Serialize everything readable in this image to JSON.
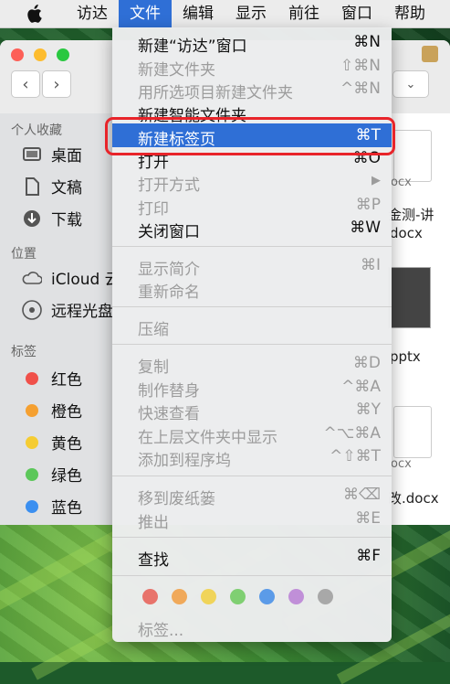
{
  "menubar": {
    "items": [
      "访达",
      "文件",
      "编辑",
      "显示",
      "前往",
      "窗口",
      "帮助"
    ],
    "active_index": 1
  },
  "sidebar": {
    "favorites_header": "个人收藏",
    "favorites": [
      "桌面",
      "文稿",
      "下载"
    ],
    "locations_header": "位置",
    "locations": [
      "iCloud 云",
      "远程光盘"
    ],
    "tags_header": "标签",
    "tags": [
      {
        "label": "红色",
        "color": "#f0504a"
      },
      {
        "label": "橙色",
        "color": "#f5a031"
      },
      {
        "label": "黄色",
        "color": "#f5cc33"
      },
      {
        "label": "绿色",
        "color": "#5cc75a"
      },
      {
        "label": "蓝色",
        "color": "#3b8ff0"
      }
    ]
  },
  "content": {
    "files": [
      "ocx",
      "金测-讲",
      "docx",
      "pptx",
      "ocx",
      "改.docx"
    ]
  },
  "file_menu": {
    "items": [
      {
        "label": "新建“访达”窗口",
        "shortcut": "⌘N",
        "enabled": true
      },
      {
        "label": "新建文件夹",
        "shortcut": "⇧⌘N",
        "enabled": false
      },
      {
        "label": "用所选项目新建文件夹",
        "shortcut": "^⌘N",
        "enabled": false
      },
      {
        "label": "新建智能文件夹",
        "shortcut": "",
        "enabled": true
      },
      {
        "label": "新建标签页",
        "shortcut": "⌘T",
        "enabled": true,
        "highlighted": true
      },
      {
        "label": "打开",
        "shortcut": "⌘O",
        "enabled": true
      },
      {
        "label": "打开方式",
        "shortcut": "▶",
        "enabled": false
      },
      {
        "label": "打印",
        "shortcut": "⌘P",
        "enabled": false
      },
      {
        "label": "关闭窗口",
        "shortcut": "⌘W",
        "enabled": true
      },
      {
        "label": "显示简介",
        "shortcut": "⌘I",
        "enabled": false
      },
      {
        "label": "重新命名",
        "shortcut": "",
        "enabled": false
      },
      {
        "label": "压缩",
        "shortcut": "",
        "enabled": false
      },
      {
        "label": "复制",
        "shortcut": "⌘D",
        "enabled": false
      },
      {
        "label": "制作替身",
        "shortcut": "^⌘A",
        "enabled": false
      },
      {
        "label": "快速查看",
        "shortcut": "⌘Y",
        "enabled": false
      },
      {
        "label": "在上层文件夹中显示",
        "shortcut": "^⌥⌘A",
        "enabled": false
      },
      {
        "label": "添加到程序坞",
        "shortcut": "^⇧⌘T",
        "enabled": false
      },
      {
        "label": "移到废纸篓",
        "shortcut": "⌘⌫",
        "enabled": false
      },
      {
        "label": "推出",
        "shortcut": "⌘E",
        "enabled": false
      },
      {
        "label": "查找",
        "shortcut": "⌘F",
        "enabled": true
      }
    ],
    "tag_colors": [
      "#e8736b",
      "#f0a95a",
      "#f0d45a",
      "#7fcf72",
      "#5b9be8",
      "#c08fd8",
      "#a8a8a8"
    ],
    "tags_label": "标签..."
  }
}
